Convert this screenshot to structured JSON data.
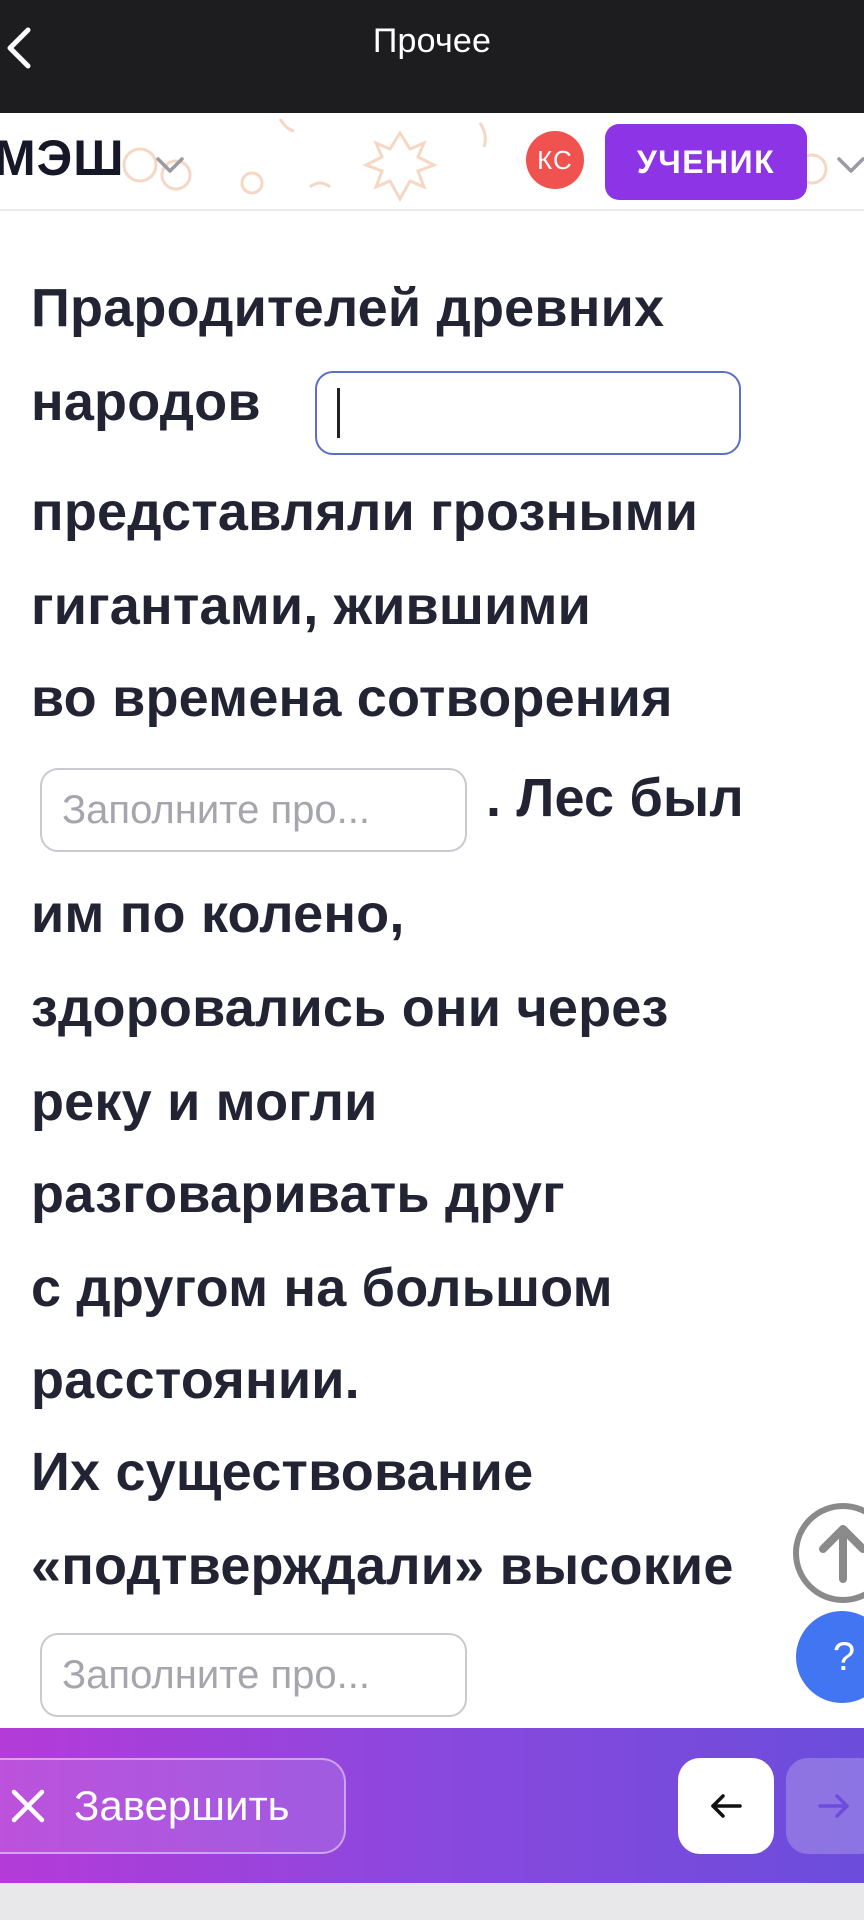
{
  "topbar": {
    "title": "Прочее",
    "back_icon": "chevron-left-icon"
  },
  "header": {
    "logo": "МЭШ",
    "avatar_initials": "КС",
    "role_label": "УЧЕНИК",
    "accent_color": "#8c34e6",
    "avatar_color": "#f0534f"
  },
  "content": {
    "lines": [
      "Прародителей древних",
      "народов",
      "представляли грозными",
      "гигантами, жившими",
      "во времена сотворения",
      ". Лес был",
      "им по колено,",
      "здоровались они через",
      "реку и могли",
      "разговаривать друг",
      "с другом на большом",
      "расстоянии.",
      "Их существование",
      "«подтверждали» высокие"
    ],
    "field_1_value": "",
    "field_2_placeholder": "Заполните про...",
    "field_3_placeholder": "Заполните про..."
  },
  "fabs": {
    "scroll_up_icon": "arrow-up-circle-icon",
    "help_label": "?"
  },
  "bottom": {
    "finish_label": "Завершить",
    "prev_icon": "arrow-left-icon",
    "next_icon": "arrow-right-icon",
    "gradient_start": "#b43bd8",
    "gradient_end": "#6b4ddb"
  }
}
